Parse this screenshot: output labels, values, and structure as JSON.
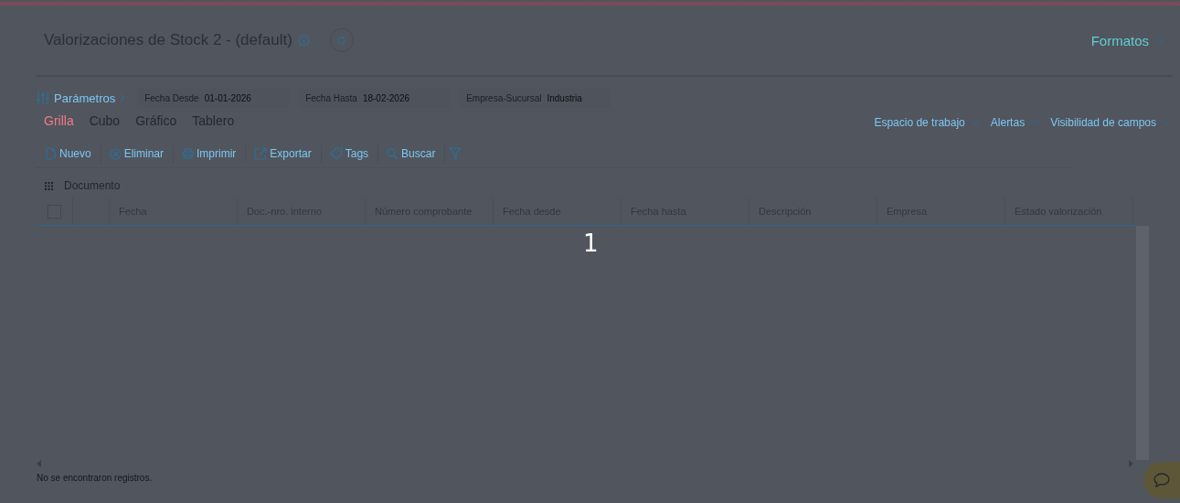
{
  "header": {
    "title": "Valorizaciones de Stock 2 - (default)",
    "formats_menu": "Formatos"
  },
  "parameters": {
    "label": "Parámetros",
    "filters": [
      {
        "label": "Fecha Desde",
        "value": "01-01-2026"
      },
      {
        "label": "Fecha Hasta",
        "value": "18-02-2026"
      },
      {
        "label": "Empresa-Sucursal",
        "value": "Industria"
      }
    ]
  },
  "view_tabs": [
    {
      "label": "Grilla",
      "selected": true
    },
    {
      "label": "Cubo",
      "selected": false
    },
    {
      "label": "Gráfico",
      "selected": false
    },
    {
      "label": "Tablero",
      "selected": false
    }
  ],
  "menus": [
    "Espacio de trabajo",
    "Alertas",
    "Visibilidad de campos"
  ],
  "toolbar": [
    {
      "kind": "new",
      "label": "Nuevo"
    },
    {
      "kind": "delete",
      "label": "Eliminar"
    },
    {
      "kind": "print",
      "label": "Imprimir"
    },
    {
      "kind": "export",
      "label": "Exportar"
    },
    {
      "kind": "tag",
      "label": "Tags"
    },
    {
      "kind": "search",
      "label": "Buscar"
    },
    {
      "kind": "filter"
    }
  ],
  "group": "Documento",
  "table": {
    "select_all_checked": false,
    "columns": [
      "Fecha",
      "Doc.-nro. interno",
      "Número comprobante",
      "Fecha desde",
      "Fecha hasta",
      "Descripción",
      "Empresa",
      "Estado valorización"
    ]
  },
  "overlay_counter": "1",
  "status_bar": "No se encontraron registros."
}
